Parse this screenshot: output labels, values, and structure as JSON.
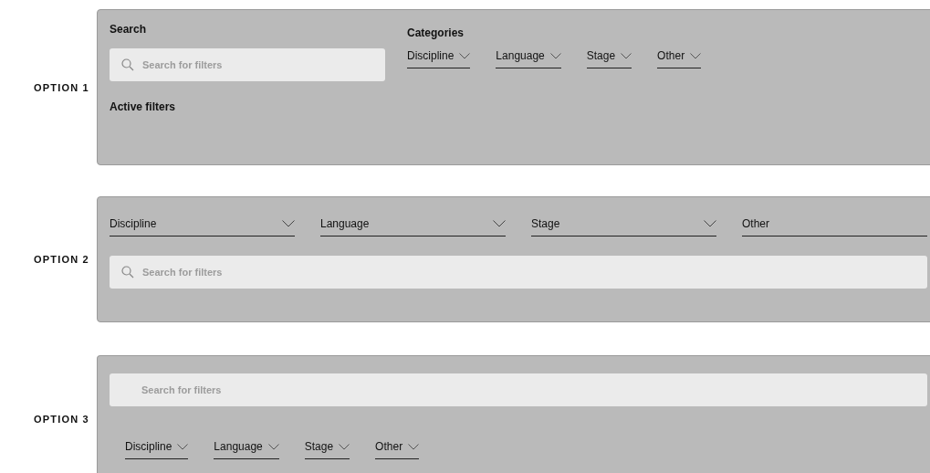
{
  "options": [
    {
      "label": "OPTION 1",
      "kind": "side-by-side",
      "search_heading": "Search",
      "search": {
        "placeholder": "Search for filters",
        "icon": true
      },
      "categories_heading": "Categories",
      "dropdowns": [
        {
          "label": "Discipline",
          "chevron": true
        },
        {
          "label": "Language",
          "chevron": true
        },
        {
          "label": "Stage",
          "chevron": true
        },
        {
          "label": "Other",
          "chevron": true
        }
      ],
      "active_filters_heading": "Active filters"
    },
    {
      "label": "OPTION 2",
      "kind": "wide-dropdowns",
      "search": {
        "placeholder": "Search for filters",
        "icon": true
      },
      "dropdowns": [
        {
          "label": "Discipline",
          "chevron": true
        },
        {
          "label": "Language",
          "chevron": true
        },
        {
          "label": "Stage",
          "chevron": true
        },
        {
          "label": "Other",
          "chevron": false
        }
      ]
    },
    {
      "label": "OPTION 3",
      "kind": "search-first",
      "search": {
        "placeholder": "Search for filters",
        "icon": false
      },
      "dropdowns": [
        {
          "label": "Discipline",
          "chevron": true
        },
        {
          "label": "Language",
          "chevron": true
        },
        {
          "label": "Stage",
          "chevron": true
        },
        {
          "label": "Other",
          "chevron": true
        }
      ]
    }
  ]
}
